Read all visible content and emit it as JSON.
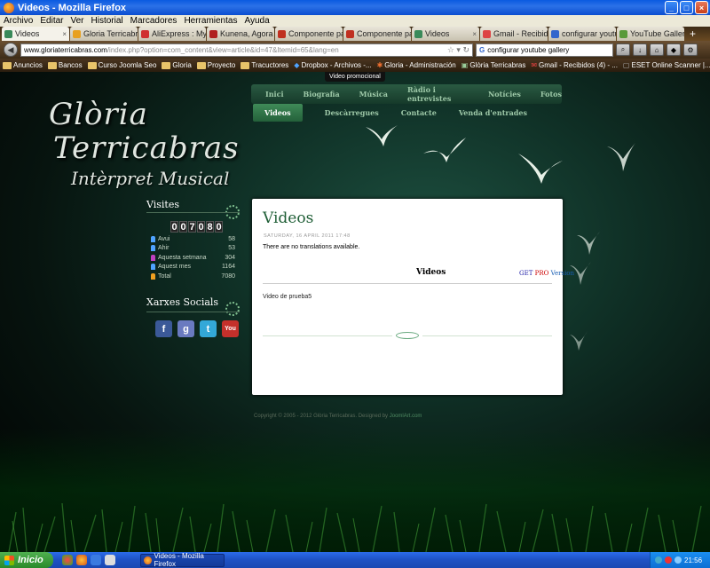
{
  "window": {
    "title": "Videos - Mozilla Firefox"
  },
  "menu": [
    "Archivo",
    "Editar",
    "Ver",
    "Historial",
    "Marcadores",
    "Herramientas",
    "Ayuda"
  ],
  "tabs": [
    {
      "label": "Videos",
      "color": "#3a8a5a",
      "active": true
    },
    {
      "label": "Gloria Terricabras ...",
      "color": "#e8a020"
    },
    {
      "label": "AliExpress : My Ali...",
      "color": "#d03030"
    },
    {
      "label": "Kunena, Agora y ...",
      "color": "#b02020"
    },
    {
      "label": "Componente para...",
      "color": "#c03020"
    },
    {
      "label": "Componente para...",
      "color": "#c03020"
    },
    {
      "label": "Videos",
      "color": "#3a8a5a"
    },
    {
      "label": "Gmail - Recibidos -...",
      "color": "#d44"
    },
    {
      "label": "configurar youtub...",
      "color": "#3366cc"
    },
    {
      "label": "YouTube Gallery -...",
      "color": "#5a9a3a"
    }
  ],
  "nav": {
    "url_domain": "www.gloriaterricabras.com",
    "url_path": "/index.php?option=com_content&view=article&id=47&Itemid=65&lang=en",
    "search_value": "configurar youtube gallery"
  },
  "bookmarks": [
    "Anuncios",
    "Bancos",
    "Curso Joomla Seo",
    "Gloria",
    "Proyecto",
    "Tracuctores",
    "Dropbox - Archivos -...",
    "Gloria - Administración",
    "Glòria Terricabras",
    "Gmail - Recibidos (4) - ...",
    "ESET Online Scanner |..."
  ],
  "page": {
    "tooltip": "Video promocional",
    "logo_line1": "Glòria",
    "logo_line2": "Terricabras",
    "logo_line3": "Intèrpret Musical",
    "main_nav": [
      "Inici",
      "Biografia",
      "Música",
      "Ràdio i entrevistes",
      "Notícies",
      "Fotos"
    ],
    "sub_nav": [
      "Videos",
      "Descàrregues",
      "Contacte",
      "Venda d'entrades"
    ],
    "visits_title": "Visites",
    "counter_digits": [
      "0",
      "0",
      "7",
      "0",
      "8",
      "0"
    ],
    "visits": [
      {
        "label": "Avui",
        "value": "58",
        "color": "#4fa3ff"
      },
      {
        "label": "Ahir",
        "value": "53",
        "color": "#4fa3ff"
      },
      {
        "label": "Aquesta setmana",
        "value": "304",
        "color": "#c040c0"
      },
      {
        "label": "Aquest mes",
        "value": "1164",
        "color": "#4fa3ff"
      },
      {
        "label": "Total",
        "value": "7080",
        "color": "#f0a020"
      }
    ],
    "social_title": "Xarxes Socials",
    "social": [
      {
        "name": "facebook",
        "glyph": "f",
        "color": "#3b5998"
      },
      {
        "name": "google",
        "glyph": "g",
        "color": "#6a7ac0"
      },
      {
        "name": "twitter",
        "glyph": "t",
        "color": "#33a8d8"
      },
      {
        "name": "youtube",
        "glyph": "You",
        "color": "#c4302b"
      }
    ],
    "content": {
      "title": "Videos",
      "date": "SATURDAY, 16 APRIL 2011 17:48",
      "no_translation": "There are no translations available.",
      "gallery_title": "Videos",
      "getpro_1": "GET",
      "getpro_2": "PRO",
      "getpro_3": "Version",
      "description": "Video de prueba5"
    },
    "footer_text": "Copyright © 2005 - 2012 Glòria Terricabras. Designed by ",
    "footer_link": "JoomlArt.com"
  },
  "taskbar": {
    "start": "Inicio",
    "task": "Videos - Mozilla Firefox",
    "clock": "21:56"
  }
}
